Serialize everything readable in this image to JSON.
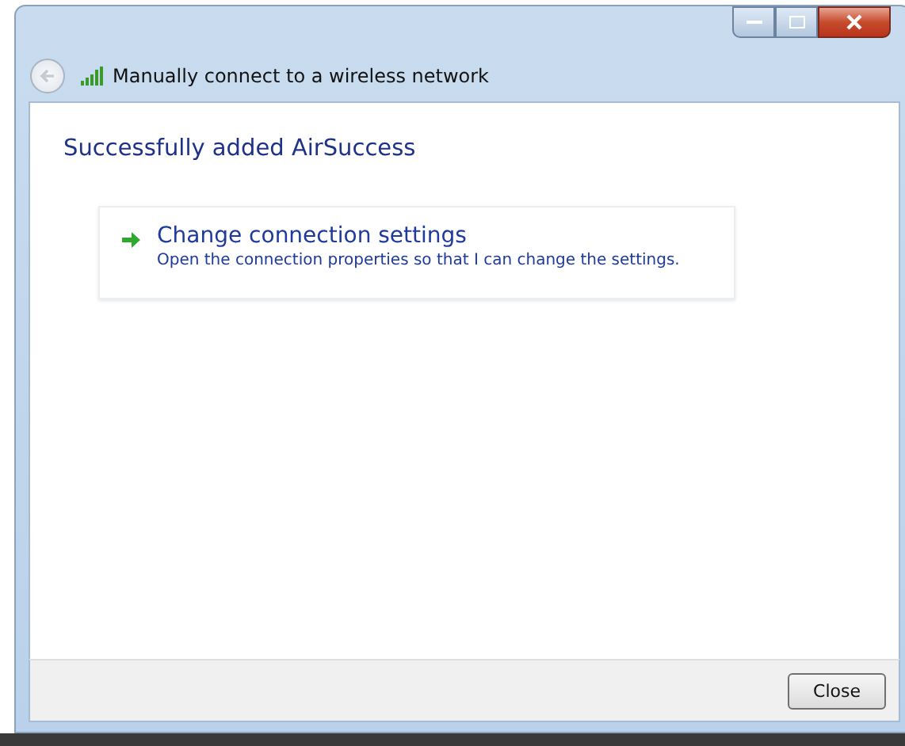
{
  "window": {
    "title": "Manually connect to a wireless network"
  },
  "heading": "Successfully added AirSuccess",
  "command_links": [
    {
      "title": "Change connection settings",
      "description": "Open the connection properties so that I can change the settings."
    }
  ],
  "buttons": [
    "Close"
  ]
}
